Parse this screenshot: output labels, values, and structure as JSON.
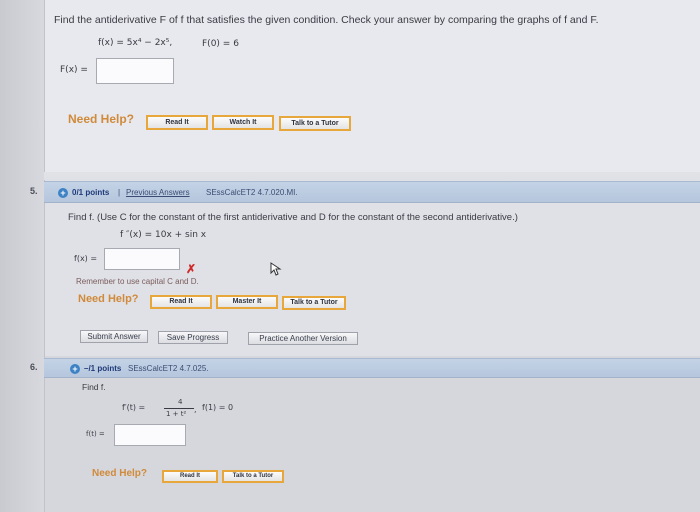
{
  "previous_question": {
    "prompt": "Find the antiderivative F of f that satisfies the given condition. Check your answer by comparing the graphs of f and F.",
    "function": "f(x) = 5x⁴ − 2x⁵,",
    "condition": "F(0) = 6",
    "answer_label": "F(x) =",
    "answer_value": "",
    "need_help": "Need Help?",
    "buttons": [
      "Read It",
      "Watch It",
      "Talk to a Tutor"
    ]
  },
  "q5": {
    "number": "5.",
    "points": "0/1 points",
    "separator": "|",
    "previous_answers": "Previous Answers",
    "source": "SEssCalcET2 4.7.020.MI.",
    "prompt": "Find f. (Use C for the constant of the first antiderivative and D for the constant of the second antiderivative.)",
    "function": "f ″(x) = 10x + sin x",
    "answer_label": "f(x) =",
    "answer_value": "",
    "remember": "Remember to use capital C and D.",
    "need_help": "Need Help?",
    "buttons": [
      "Read It",
      "Master It",
      "Talk to a Tutor"
    ],
    "actions": [
      "Submit Answer",
      "Save Progress",
      "Practice Another Version"
    ]
  },
  "q6": {
    "number": "6.",
    "points": "–/1 points",
    "source": "SEssCalcET2 4.7.025.",
    "prompt": "Find f.",
    "function_lhs": "f′(t) =",
    "function_num": "4",
    "function_den": "1 + t²",
    "function_comma": ",",
    "condition": "f(1) = 0",
    "answer_label": "f(t) =",
    "answer_value": "",
    "need_help": "Need Help?",
    "buttons": [
      "Read It",
      "Talk to a Tutor"
    ]
  },
  "colors": {
    "accent_orange": "#e7a73a",
    "header_blue": "#b5c6dd",
    "error_red": "#d02a2a",
    "plus_blue": "#3d82c4"
  }
}
